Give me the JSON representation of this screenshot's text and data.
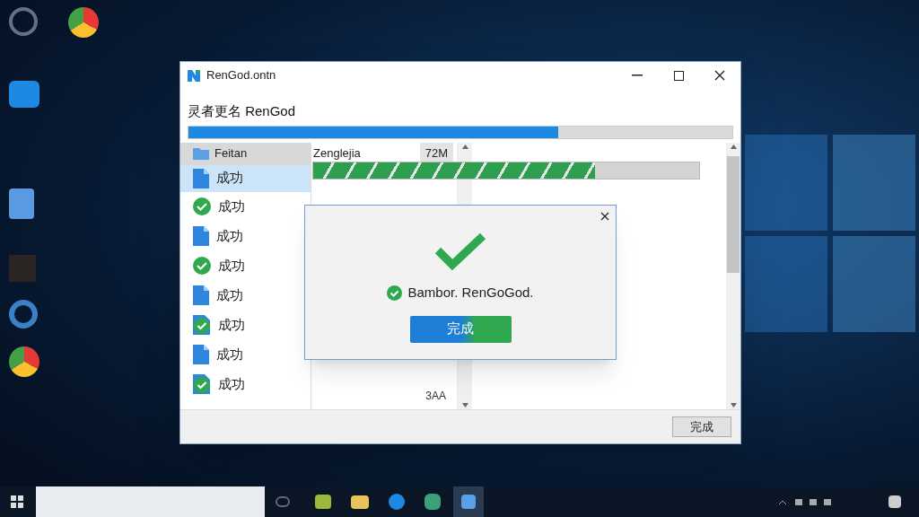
{
  "window": {
    "title": "RenGod.ontn",
    "heading": "灵者更名 RenGod",
    "progress": {
      "level": 0.68
    }
  },
  "list": {
    "header": "Feitan",
    "items": [
      {
        "label": "成功",
        "kind": "file",
        "selected": true
      },
      {
        "label": "成功",
        "kind": "check",
        "selected": false
      },
      {
        "label": "成功",
        "kind": "file",
        "selected": false
      },
      {
        "label": "成功",
        "kind": "check",
        "selected": false
      },
      {
        "label": "成功",
        "kind": "file",
        "selected": false
      },
      {
        "label": "成功",
        "kind": "file-check",
        "selected": false
      },
      {
        "label": "成功",
        "kind": "file",
        "selected": false
      },
      {
        "label": "成功",
        "kind": "file-check",
        "selected": false
      }
    ]
  },
  "details": {
    "header": "Zenglejia",
    "header_size": "72M",
    "last_size": "3AA",
    "transfer": {
      "level": 0.73
    }
  },
  "dialog": {
    "message": "Bambor. RenGoGod.",
    "button": "完成"
  },
  "footer_button": "完成"
}
